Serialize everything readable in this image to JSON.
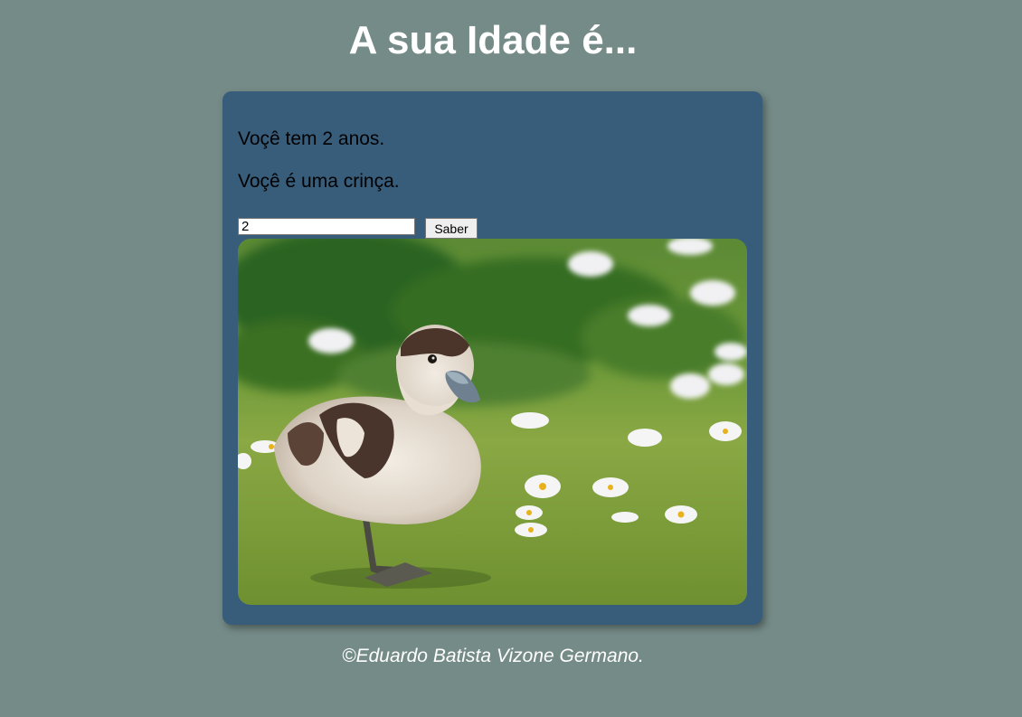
{
  "header": {
    "title": "A sua Idade é..."
  },
  "card": {
    "age_message": "Voçê tem 2 anos.",
    "category_message": "Voçê é uma crinça.",
    "age_input": {
      "value": "2",
      "placeholder": ""
    },
    "submit_label": "Saber",
    "image_subject": "duckling-photo"
  },
  "footer": {
    "text": "©Eduardo Batista Vizone Germano."
  },
  "colors": {
    "background": "#758b87",
    "card": "#385d7b",
    "title_text": "#ffffff"
  }
}
